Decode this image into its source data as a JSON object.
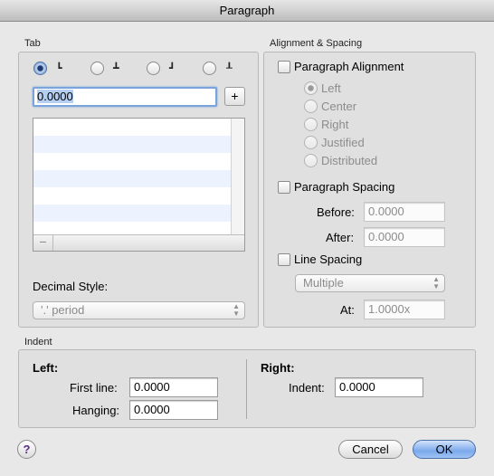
{
  "window": {
    "title": "Paragraph"
  },
  "tab": {
    "group_label": "Tab",
    "alignments": [
      {
        "icon": "tab-left-icon",
        "glyph": "┗",
        "selected": true
      },
      {
        "icon": "tab-center-icon",
        "glyph": "┻",
        "selected": false
      },
      {
        "icon": "tab-right-icon",
        "glyph": "┛",
        "selected": false
      },
      {
        "icon": "tab-decimal-icon",
        "glyph": "┸",
        "selected": false
      }
    ],
    "position_value": "0.0000",
    "add_label": "+",
    "remove_label": "−",
    "decimal_style_label": "Decimal Style:",
    "decimal_style_value": "'.' period"
  },
  "alignment_spacing": {
    "group_label": "Alignment & Spacing",
    "paragraph_alignment": {
      "label": "Paragraph Alignment",
      "checked": false,
      "options": [
        "Left",
        "Center",
        "Right",
        "Justified",
        "Distributed"
      ],
      "selected": "Left"
    },
    "paragraph_spacing": {
      "label": "Paragraph Spacing",
      "checked": false,
      "before_label": "Before:",
      "before_value": "0.0000",
      "after_label": "After:",
      "after_value": "0.0000"
    },
    "line_spacing": {
      "label": "Line Spacing",
      "checked": false,
      "mode_value": "Multiple",
      "at_label": "At:",
      "at_value": "1.0000x"
    }
  },
  "indent": {
    "group_label": "Indent",
    "left_heading": "Left:",
    "first_line_label": "First line:",
    "first_line_value": "0.0000",
    "hanging_label": "Hanging:",
    "hanging_value": "0.0000",
    "right_heading": "Right:",
    "right_indent_label": "Indent:",
    "right_indent_value": "0.0000"
  },
  "buttons": {
    "help_label": "?",
    "cancel_label": "Cancel",
    "ok_label": "OK"
  },
  "colors": {
    "accent": "#7ba9ec",
    "list_alt_row": "#edf3fe",
    "help_glyph": "#5a2d88"
  }
}
